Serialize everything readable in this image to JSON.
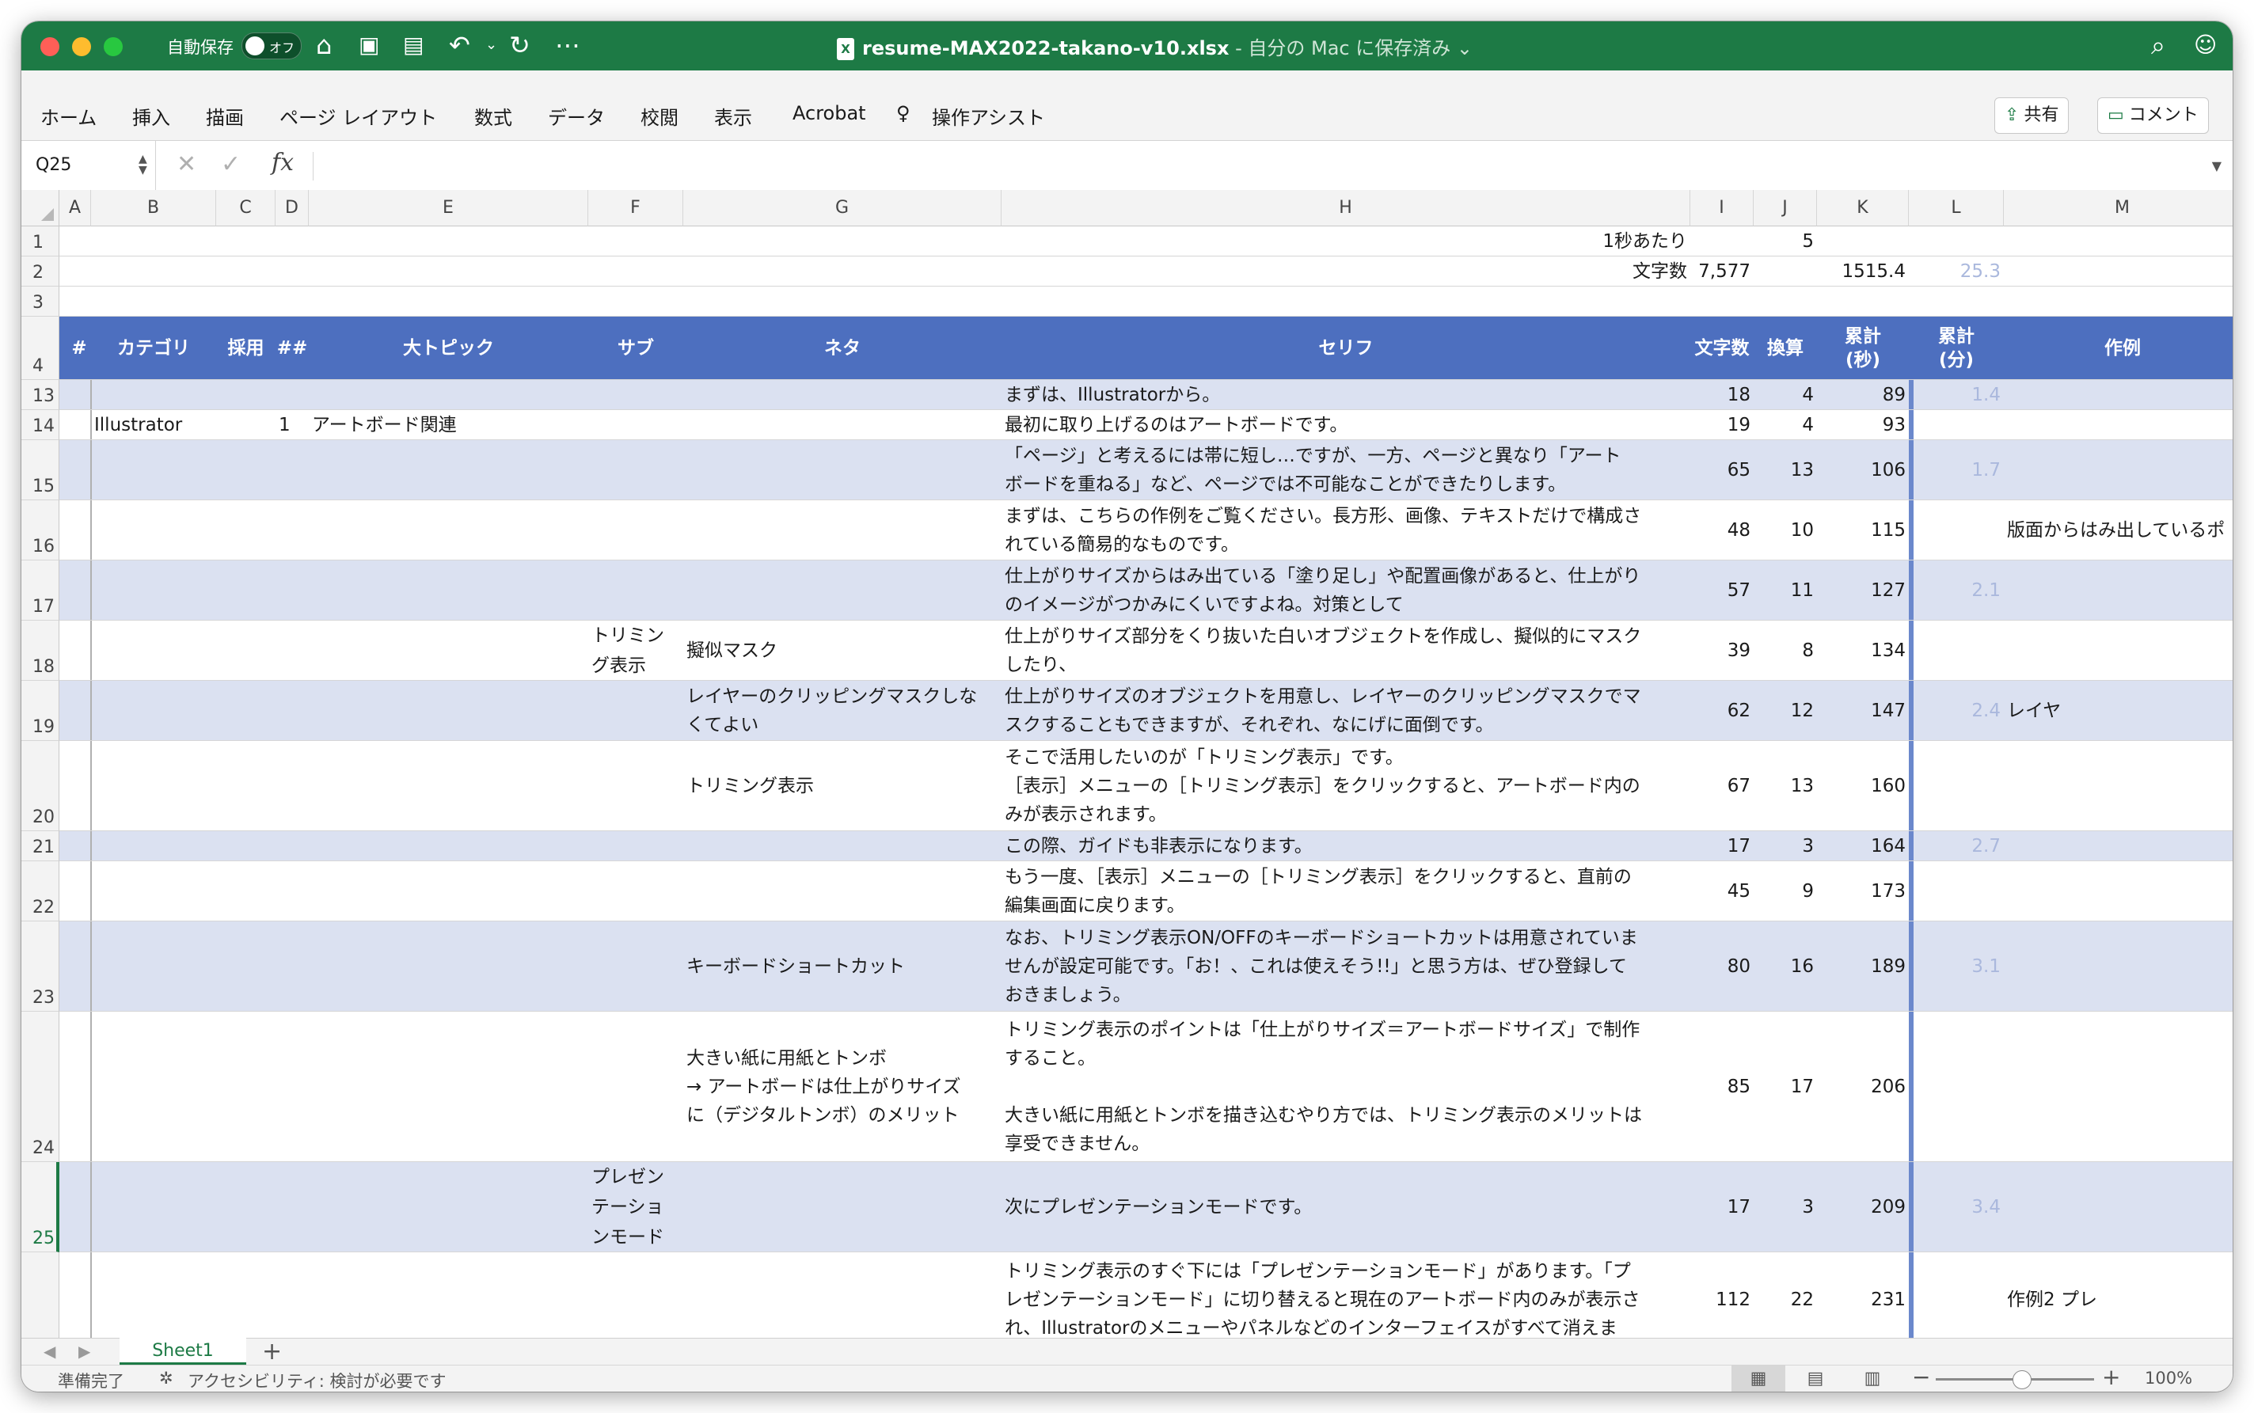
{
  "titlebar": {
    "autosave_label": "自動保存",
    "autosave_state": "オフ",
    "filename": "resume-MAX2022-takano-v10.xlsx",
    "save_status": " - 自分の Mac に保存済み ⌄",
    "icons": [
      "home-icon",
      "save-icon",
      "save-as-icon",
      "undo-icon",
      "redo-icon",
      "more-icon",
      "search-icon",
      "account-icon"
    ]
  },
  "ribbon": {
    "tabs": [
      "ホーム",
      "挿入",
      "描画",
      "ページ レイアウト",
      "数式",
      "データ",
      "校閲",
      "表示",
      "Acrobat",
      "操作アシスト"
    ],
    "share_label": "共有",
    "comment_label": "コメント"
  },
  "formula_bar": {
    "cell_ref": "Q25",
    "fx_label": "fx",
    "value": ""
  },
  "columns": [
    "A",
    "B",
    "C",
    "D",
    "E",
    "F",
    "G",
    "H",
    "I",
    "J",
    "K",
    "L",
    "M"
  ],
  "rows": [
    {
      "n": "1",
      "cells": {
        "H": "1秒あたり",
        "J": "5"
      }
    },
    {
      "n": "2",
      "cells": {
        "H": "文字数",
        "I": "7,577",
        "K": "1515.4",
        "L": "25.3"
      }
    },
    {
      "n": "3",
      "cells": {}
    },
    {
      "n": "4",
      "header": true,
      "cells": {
        "A": "#",
        "B": "カテゴリ",
        "C": "採用",
        "D": "##",
        "E": "大トピック",
        "F": "サブ",
        "G": "ネタ",
        "H": "セリフ",
        "I": "文字数",
        "J": "換算",
        "K": "累計\n(秒)",
        "L": "累計\n(分)",
        "M": "作例"
      }
    },
    {
      "n": "13",
      "band": true,
      "cells": {
        "H": "まずは、Illustratorから。",
        "I": "18",
        "J": "4",
        "K": "89",
        "L": "1.4"
      }
    },
    {
      "n": "14",
      "cells": {
        "B": "Illustrator",
        "D": "1",
        "E": "アートボード関連",
        "H": "最初に取り上げるのはアートボードです。",
        "I": "19",
        "J": "4",
        "K": "93"
      }
    },
    {
      "n": "15",
      "band": true,
      "cells": {
        "H": "「ページ」と考えるには帯に短し…ですが、一方、ページと異なり「アート\nボードを重ねる」など、ページでは不可能なことができたりします。",
        "I": "65",
        "J": "13",
        "K": "106",
        "L": "1.7"
      }
    },
    {
      "n": "16",
      "cells": {
        "H": "まずは、こちらの作例をご覧ください。長方形、画像、テキストだけで構成さ\nれている簡易的なものです。",
        "I": "48",
        "J": "10",
        "K": "115",
        "M": "版面からはみ出しているポ"
      }
    },
    {
      "n": "17",
      "band": true,
      "cells": {
        "H": "仕上がりサイズからはみ出ている「塗り足し」や配置画像があると、仕上がり\nのイメージがつかみにくいですよね。対策として",
        "I": "57",
        "J": "11",
        "K": "127",
        "L": "2.1"
      }
    },
    {
      "n": "18",
      "cells": {
        "F": "トリミン\nグ表示",
        "G": "擬似マスク",
        "H": "仕上がりサイズ部分をくり抜いた白いオブジェクトを作成し、擬似的にマスク\nしたり、",
        "I": "39",
        "J": "8",
        "K": "134"
      }
    },
    {
      "n": "19",
      "band": true,
      "cells": {
        "G": "レイヤーのクリッピングマスクしな\nくてよい",
        "H": "仕上がりサイズのオブジェクトを用意し、レイヤーのクリッピングマスクでマ\nスクすることもできますが、それぞれ、なにげに面倒です。",
        "I": "62",
        "J": "12",
        "K": "147",
        "L": "2.4",
        "M": "レイヤ"
      }
    },
    {
      "n": "20",
      "cells": {
        "G": "トリミング表示",
        "H": "そこで活用したいのが「トリミング表示」です。\n［表示］メニューの［トリミング表示］をクリックすると、アートボード内の\nみが表示されます。",
        "I": "67",
        "J": "13",
        "K": "160"
      }
    },
    {
      "n": "21",
      "band": true,
      "cells": {
        "H": "この際、ガイドも非表示になります。",
        "I": "17",
        "J": "3",
        "K": "164",
        "L": "2.7"
      }
    },
    {
      "n": "22",
      "cells": {
        "H": "もう一度、［表示］メニューの［トリミング表示］をクリックすると、直前の\n編集画面に戻ります。",
        "I": "45",
        "J": "9",
        "K": "173"
      }
    },
    {
      "n": "23",
      "band": true,
      "cells": {
        "G": "キーボードショートカット",
        "H": "なお、トリミング表示ON/OFFのキーボードショートカットは用意されていま\nせんが設定可能です。「お！、これは使えそう!!」と思う方は、ぜひ登録して\nおきましょう。",
        "I": "80",
        "J": "16",
        "K": "189",
        "L": "3.1"
      }
    },
    {
      "n": "24",
      "cells": {
        "G": "大きい紙に用紙とトンボ\n→ アートボードは仕上がりサイズ\nに（デジタルトンボ）のメリット",
        "H": "トリミング表示のポイントは「仕上がりサイズ＝アートボードサイズ」で制作\nすること。\n\n大きい紙に用紙とトンボを描き込むやり方では、トリミング表示のメリットは\n享受できません。",
        "I": "85",
        "J": "17",
        "K": "206"
      }
    },
    {
      "n": "25",
      "band": true,
      "active": true,
      "cells": {
        "F": "プレゼン\nテーショ\nンモード",
        "H": "次にプレゼンテーションモードです。",
        "I": "17",
        "J": "3",
        "K": "209",
        "L": "3.4"
      }
    },
    {
      "n": "",
      "cells": {
        "H": "トリミング表示のすぐ下には「プレゼンテーションモード」があります。「プ\nレゼンテーションモード」に切り替えると現在のアートボード内のみが表示さ\nれ、Illustratorのメニューやパネルなどのインターフェイスがすべて消えま",
        "I": "112",
        "J": "22",
        "K": "231",
        "M": "作例2                    プレ"
      }
    }
  ],
  "sheets": [
    "Sheet1"
  ],
  "status": {
    "ready": "準備完了",
    "accessibility": "アクセシビリティ: 検討が必要です",
    "zoom": "100%"
  },
  "colors": {
    "excel_green": "#1d7a45",
    "header_blue": "#4d6fbf",
    "band_blue": "#dbe1f1"
  }
}
